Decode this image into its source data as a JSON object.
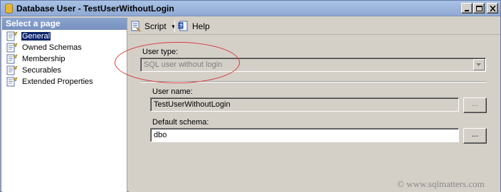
{
  "window": {
    "title": "Database User - TestUserWithoutLogin",
    "controls": [
      "minimize",
      "maximize",
      "close"
    ]
  },
  "sidebar": {
    "header": "Select a page",
    "selected": "General",
    "items": [
      {
        "label": "General",
        "icon": "page-icon"
      },
      {
        "label": "Owned Schemas",
        "icon": "page-icon"
      },
      {
        "label": "Membership",
        "icon": "page-icon"
      },
      {
        "label": "Securables",
        "icon": "page-icon"
      },
      {
        "label": "Extended Properties",
        "icon": "page-icon"
      }
    ]
  },
  "toolbar": {
    "script_label": "Script",
    "help_label": "Help"
  },
  "form": {
    "user_type_label": "User type:",
    "user_type_value": "SQL user without login",
    "user_name_label": "User name:",
    "user_name_value": "TestUserWithoutLogin",
    "default_schema_label": "Default schema:",
    "default_schema_value": "dbo",
    "browse_label": "..."
  },
  "watermark": "© www.sqlmatters.com",
  "colors": {
    "title_bar": "#a9c3e6",
    "selection": "#0a246a",
    "annotation": "#d83a3a"
  }
}
